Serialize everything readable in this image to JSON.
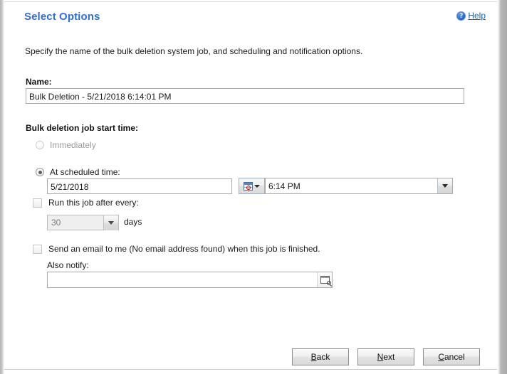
{
  "dialog": {
    "title": "Select Options",
    "help_label": "Help",
    "help_accel": "H",
    "help_icon": "question-circle-icon",
    "instruction": "Specify the name of the bulk deletion system job, and scheduling and notification options."
  },
  "name_field": {
    "label": "Name:",
    "value": "Bulk Deletion - 5/21/2018 6:14:01 PM",
    "placeholder": ""
  },
  "start_time": {
    "label": "Bulk deletion job start time:",
    "options": [
      {
        "label": "Immediately",
        "selected": false,
        "enabled": false
      },
      {
        "label": "At scheduled time:",
        "selected": true,
        "enabled": true
      }
    ],
    "date": {
      "value": "5/21/2018",
      "picker_icon": "calendar-icon",
      "picker_chevron": "chevron-down-icon"
    },
    "time": {
      "value": "6:14 PM",
      "chevron": "chevron-down-icon"
    }
  },
  "recurrence": {
    "checkbox_label": "Run this job after every:",
    "checked": false,
    "interval_value": "30",
    "interval_chevron": "chevron-down-icon",
    "unit_label": "days",
    "enabled": false
  },
  "notification": {
    "email_checkbox_label": "Send an email to me (No email address found) when this job is finished.",
    "email_checked": false,
    "also_notify_label": "Also notify:",
    "also_notify_value": "",
    "lookup_icon": "lookup-search-icon"
  },
  "footer": {
    "buttons": [
      {
        "name": "back",
        "label": "Back",
        "accel": "B",
        "rest": "ack"
      },
      {
        "name": "next",
        "label": "Next",
        "accel": "N",
        "rest": "ext"
      },
      {
        "name": "cancel",
        "label": "Cancel",
        "accel": "C",
        "rest": "ancel"
      }
    ]
  },
  "colors": {
    "title_blue": "#2e6ed6",
    "link_blue": "#1a5fb4",
    "page_bg": "#ffffff",
    "frame_grey": "#b4b4b4",
    "disabled_text": "#9a9a9a"
  }
}
